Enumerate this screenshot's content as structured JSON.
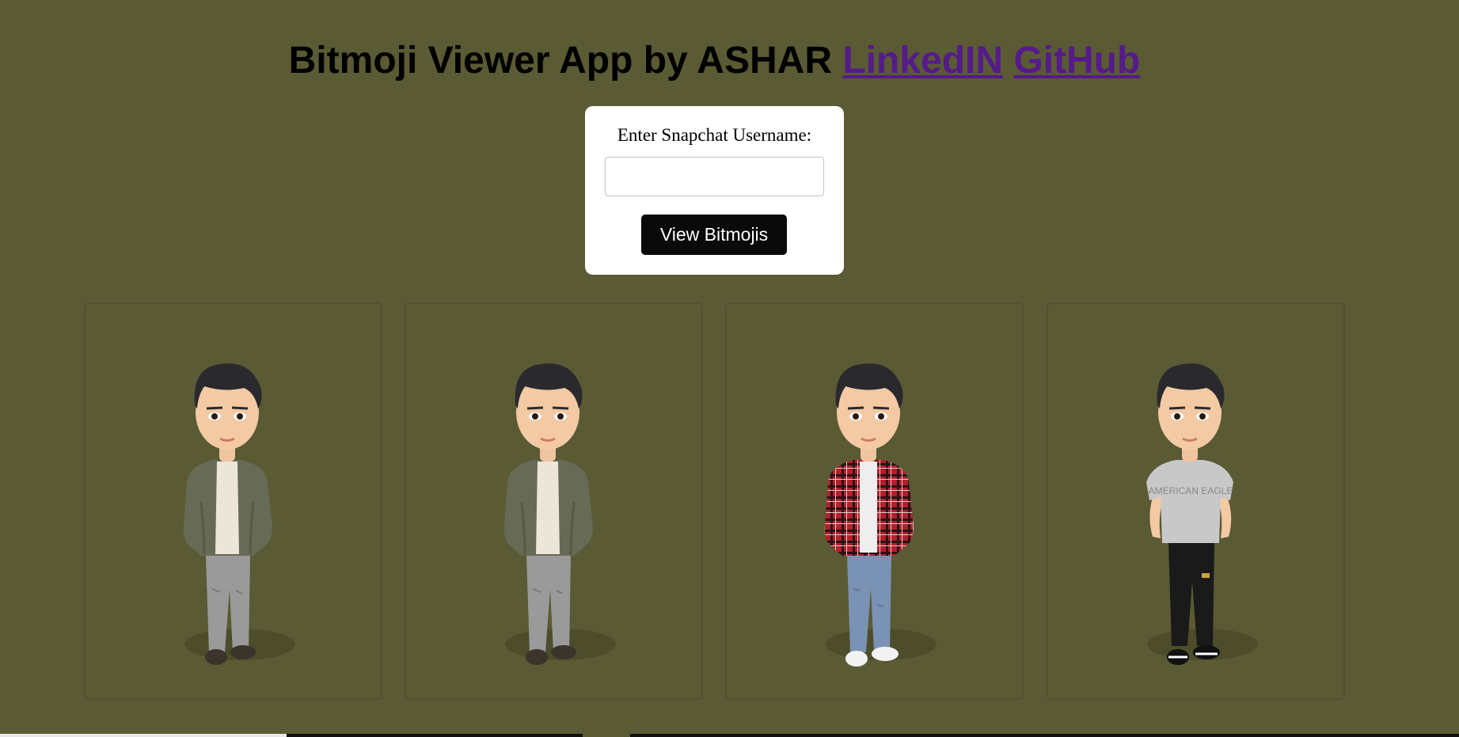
{
  "header": {
    "title_text": "Bitmoji Viewer App by ASHAR",
    "linkedin_label": "LinkedIN",
    "github_label": "GitHub"
  },
  "form": {
    "label": "Enter Snapchat Username:",
    "input_value": "",
    "input_placeholder": "",
    "button_label": "View Bitmojis"
  },
  "gallery": {
    "cards": [
      {
        "icon": "bitmoji-avatar-icon",
        "outfit": "green bomber jacket, grey jeans, dark sneakers"
      },
      {
        "icon": "bitmoji-avatar-icon",
        "outfit": "green bomber jacket, grey jeans, dark sneakers"
      },
      {
        "icon": "bitmoji-avatar-icon",
        "outfit": "red plaid shirt, blue jeans, white sneakers"
      },
      {
        "icon": "bitmoji-avatar-icon",
        "outfit": "grey tee, black joggers, black sneakers",
        "shirt_text": "AMERICAN EAGLE"
      }
    ]
  },
  "colors": {
    "background": "#5a5a34",
    "link": "#551a8b",
    "button": "#0a0a0a",
    "card_border": "#525230"
  }
}
